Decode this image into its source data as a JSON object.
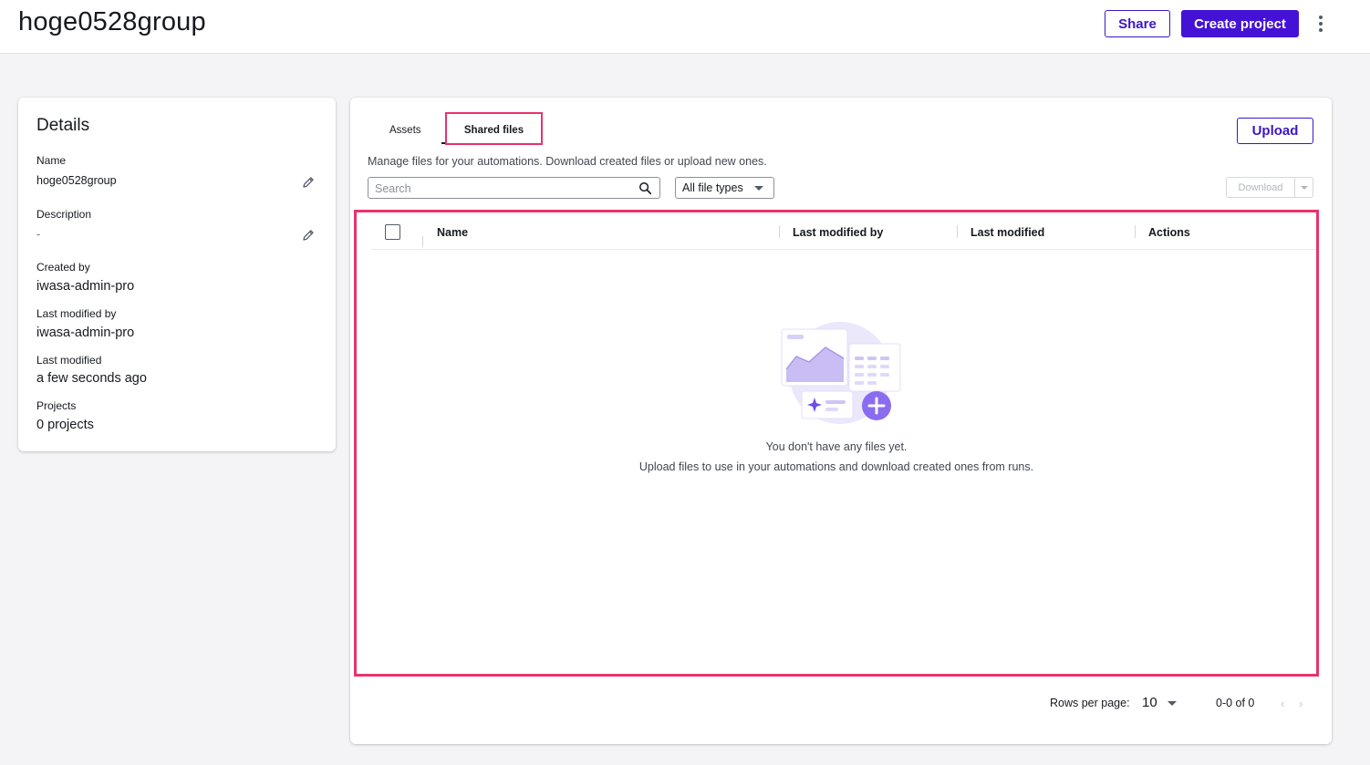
{
  "header": {
    "title": "hoge0528group",
    "share_label": "Share",
    "create_project_label": "Create project"
  },
  "details": {
    "title": "Details",
    "fields": [
      {
        "label": "Name",
        "value": "hoge0528group"
      },
      {
        "label": "Description",
        "value": "-"
      },
      {
        "label": "Created by",
        "value": "iwasa-admin-pro"
      },
      {
        "label": "Last modified by",
        "value": "iwasa-admin-pro"
      },
      {
        "label": "Last modified",
        "value": "a few seconds ago"
      },
      {
        "label": "Projects",
        "value": "0 projects"
      }
    ]
  },
  "main": {
    "tabs": [
      {
        "label": "Assets",
        "active": false
      },
      {
        "label": "Shared files",
        "active": true
      }
    ],
    "upload_label": "Upload",
    "description": "Manage files for your automations. Download created files or upload new ones.",
    "search": {
      "placeholder": "Search",
      "value": ""
    },
    "file_type_filter": {
      "selected": "All file types"
    },
    "download_label": "Download",
    "table": {
      "columns": [
        "Name",
        "Last modified by",
        "Last modified",
        "Actions"
      ],
      "rows": []
    },
    "empty_state": {
      "title": "You don't have any files yet.",
      "subtitle": "Upload files to use in your automations and download created ones from runs."
    },
    "pagination": {
      "rows_per_page_label": "Rows per page:",
      "rows_per_page": "10",
      "range": "0-0 of 0"
    }
  },
  "colors": {
    "accent": "#4412d6",
    "highlight": "#e8336b",
    "background": "#f4f4f6"
  }
}
